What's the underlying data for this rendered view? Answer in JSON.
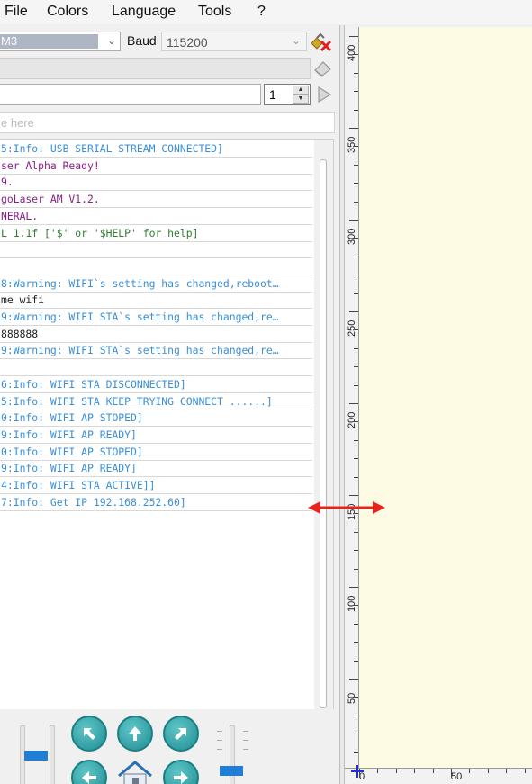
{
  "menu": {
    "file": "File",
    "colors": "Colors",
    "language": "Language",
    "tools": "Tools",
    "help": "?"
  },
  "connection": {
    "port_value": "M3",
    "baud_label": "Baud",
    "baud_value": "115200"
  },
  "command": {
    "repeat_count": "1",
    "hint_placeholder": "e here"
  },
  "console_lines": [
    {
      "text": "5:Info: USB SERIAL STREAM CONNECTED]",
      "kind": "info"
    },
    {
      "text": "ser Alpha Ready!",
      "kind": "purple"
    },
    {
      "text": "9.",
      "kind": "purple"
    },
    {
      "text": "goLaser AM V1.2.",
      "kind": "purple"
    },
    {
      "text": "NERAL.",
      "kind": "purple"
    },
    {
      "text": "L 1.1f ['$' or '$HELP' for help]",
      "kind": "green"
    },
    {
      "text": "",
      "kind": "dark"
    },
    {
      "text": "",
      "kind": "dark"
    },
    {
      "text": "8:Warning: WIFI`s setting has changed,reboot…",
      "kind": "info"
    },
    {
      "text": "me wifi",
      "kind": "dark"
    },
    {
      "text": "9:Warning: WIFI STA`s setting has changed,re…",
      "kind": "info"
    },
    {
      "text": "888888",
      "kind": "dark"
    },
    {
      "text": "9:Warning: WIFI STA`s setting has changed,re…",
      "kind": "info"
    },
    {
      "text": "",
      "kind": "dark"
    },
    {
      "text": "6:Info: WIFI STA DISCONNECTED]",
      "kind": "info"
    },
    {
      "text": "5:Info: WIFI STA KEEP TRYING CONNECT ......]",
      "kind": "info"
    },
    {
      "text": "0:Info: WIFI AP STOPED]",
      "kind": "info"
    },
    {
      "text": "9:Info: WIFI AP READY]",
      "kind": "info"
    },
    {
      "text": "0:Info: WIFI AP STOPED]",
      "kind": "info"
    },
    {
      "text": "9:Info: WIFI AP READY]",
      "kind": "info"
    },
    {
      "text": "4:Info: WIFI STA ACTIVE]]",
      "kind": "info"
    },
    {
      "text": "7:Info: Get IP 192.168.252.60]",
      "kind": "info"
    }
  ],
  "ruler": {
    "vertical_labels": [
      "400",
      "350",
      "300",
      "250",
      "200",
      "150",
      "100",
      "50",
      "0"
    ],
    "horizontal_labels": [
      "0",
      "50"
    ]
  },
  "colors": {
    "canvas_bg": "#fdfbe3",
    "info_text": "#3a8fd8",
    "firmware_text": "#8a1f88",
    "help_text": "#2e7d2e",
    "splitter_arrow": "#e8231e",
    "jog_button": "#1f8d93",
    "slider_thumb": "#1f7fd6"
  },
  "icons": {
    "disconnect": "disconnect-x-icon",
    "clear": "eraser-icon",
    "send": "play-triangle-icon",
    "jog_nw": "arrow-up-left-icon",
    "jog_n": "arrow-up-icon",
    "jog_ne": "arrow-up-right-icon",
    "jog_w": "arrow-left-icon",
    "home": "home-icon",
    "jog_e": "arrow-right-icon",
    "resize": "double-arrow-horizontal-icon"
  }
}
